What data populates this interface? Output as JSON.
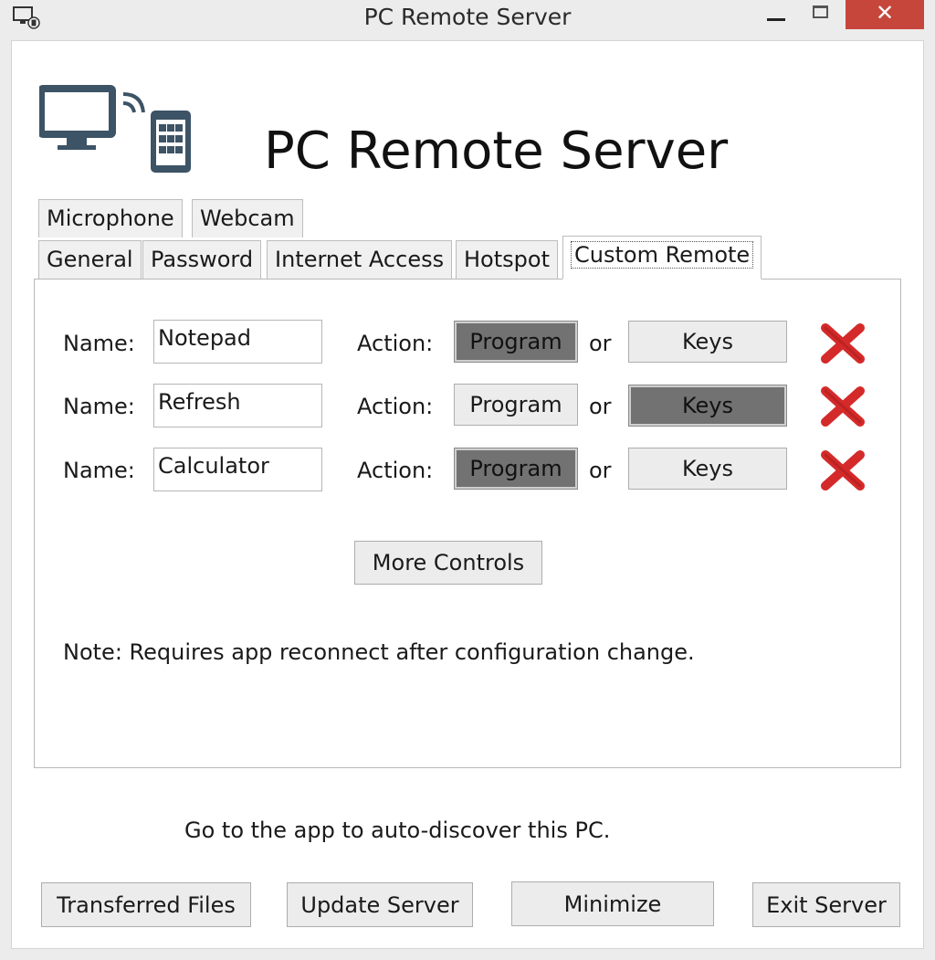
{
  "window": {
    "title": "PC Remote Server"
  },
  "header": {
    "app_title": "PC Remote Server",
    "logo_icon": "computer-phone-wireless-icon"
  },
  "tabs_row1": [
    {
      "label": "Microphone"
    },
    {
      "label": "Webcam"
    }
  ],
  "tabs_row2": [
    {
      "label": "General"
    },
    {
      "label": "Password"
    },
    {
      "label": "Internet Access"
    },
    {
      "label": "Hotspot"
    },
    {
      "label": "Custom Remote",
      "active": true
    }
  ],
  "custom_remote": {
    "name_label": "Name:",
    "action_label": "Action:",
    "or_label": "or",
    "program_label": "Program",
    "keys_label": "Keys",
    "rows": [
      {
        "name": "Notepad",
        "selected": "program"
      },
      {
        "name": "Refresh",
        "selected": "keys"
      },
      {
        "name": "Calculator",
        "selected": "program"
      }
    ],
    "more_controls": "More Controls",
    "note": "Note: Requires app reconnect after configuration change."
  },
  "footer": {
    "discover_text": "Go to the app to auto-discover this PC.",
    "buttons": [
      {
        "label": "Transferred Files"
      },
      {
        "label": "Update Server"
      },
      {
        "label": "Minimize"
      },
      {
        "label": "Exit Server"
      }
    ]
  },
  "colors": {
    "close_button": "#c7463c",
    "selected_action": "#727272",
    "delete_red": "#d42a2a"
  }
}
